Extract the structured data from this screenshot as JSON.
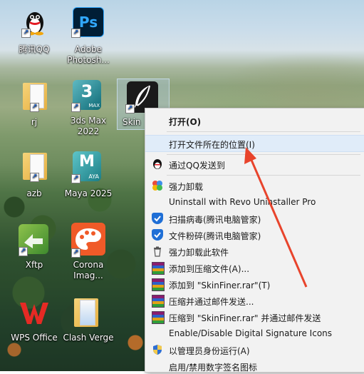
{
  "desktop": {
    "icons": [
      {
        "id": "qq",
        "label": "腾讯QQ"
      },
      {
        "id": "photoshop",
        "label": "Adobe Photosh...",
        "glyph": "Ps"
      },
      {
        "id": "rj",
        "label": "rj"
      },
      {
        "id": "3dsmax",
        "label": "3ds Max 2022",
        "glyph": "3",
        "sub": "MAX"
      },
      {
        "id": "skinfiner",
        "label": "Skin"
      },
      {
        "id": "azb",
        "label": "azb"
      },
      {
        "id": "maya",
        "label": "Maya 2025",
        "glyph": "M",
        "sub": "AYA"
      },
      {
        "id": "xftp",
        "label": "Xftp"
      },
      {
        "id": "corona",
        "label": "Corona Imag..."
      },
      {
        "id": "wps",
        "label": "WPS Office"
      },
      {
        "id": "clash",
        "label": "Clash Verge"
      }
    ]
  },
  "context_menu": {
    "items": [
      {
        "label": "打开(O)",
        "icon": "none",
        "bold": true
      },
      {
        "label": "打开文件所在的位置(I)",
        "icon": "none"
      },
      {
        "label": "通过QQ发送到",
        "icon": "qq-penguin-icon"
      },
      {
        "label": "强力卸载",
        "icon": "pinwheel-icon"
      },
      {
        "label": "Uninstall with Revo Uninstaller Pro",
        "icon": "none"
      },
      {
        "label": "扫描病毒(腾讯电脑管家)",
        "icon": "tencent-shield-icon"
      },
      {
        "label": "文件粉碎(腾讯电脑管家)",
        "icon": "tencent-shield-icon"
      },
      {
        "label": "强力卸载此软件",
        "icon": "trash-icon"
      },
      {
        "label": "添加到压缩文件(A)...",
        "icon": "winrar-icon"
      },
      {
        "label": "添加到 \"SkinFiner.rar\"(T)",
        "icon": "winrar-icon"
      },
      {
        "label": "压缩并通过邮件发送...",
        "icon": "winrar-icon"
      },
      {
        "label": "压缩到 \"SkinFiner.rar\" 并通过邮件发送",
        "icon": "winrar-icon"
      },
      {
        "label": "Enable/Disable Digital Signature Icons",
        "icon": "none"
      },
      {
        "label": "以管理员身份运行(A)",
        "icon": "uac-shield-icon"
      },
      {
        "label": "启用/禁用数字签名图标",
        "icon": "none"
      }
    ]
  },
  "colors": {
    "menu_bg": "#f2f2f2",
    "highlight": "#e0ecf9",
    "annotation_arrow": "#e8442c"
  }
}
